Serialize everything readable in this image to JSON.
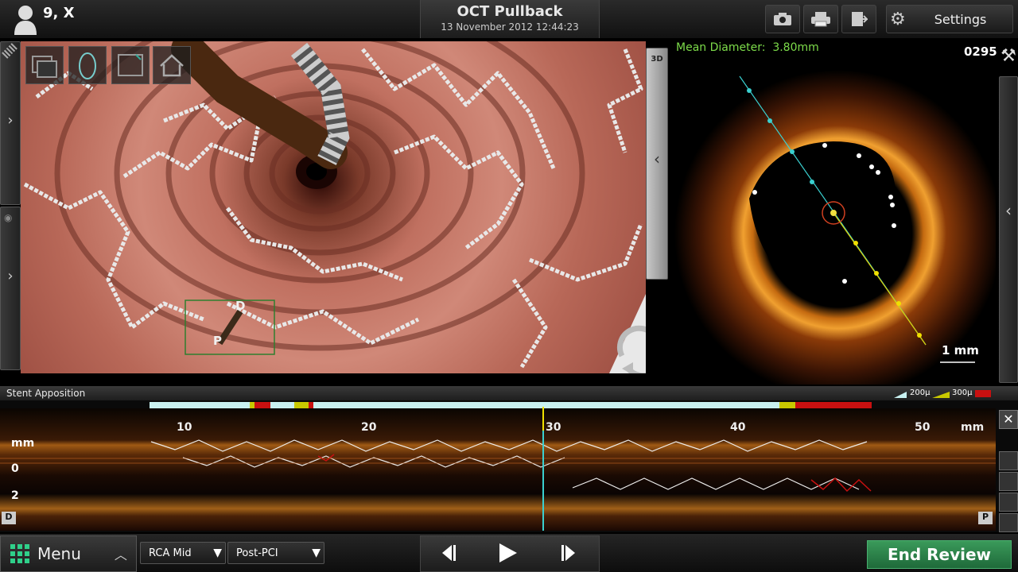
{
  "user": {
    "name": "9, X"
  },
  "title": {
    "app_title": "OCT Pullback",
    "datetime": "13 November 2012 12:44:23"
  },
  "toolbar": {
    "settings_label": "Settings"
  },
  "view3d": {
    "mode_label": "3D",
    "marker_d": "D",
    "marker_p": "P"
  },
  "oct": {
    "mean_diameter": "Mean Diameter:  3.80mm",
    "frame_number": "0295",
    "scale_label": "1 mm"
  },
  "lview": {
    "panel_label": "Stent Apposition",
    "legend": [
      "200µ",
      "300µ"
    ],
    "mm_label": "mm",
    "ticks": [
      "10",
      "20",
      "30",
      "40",
      "50"
    ],
    "axis_labels": [
      "0",
      "2"
    ],
    "end_d": "D",
    "end_p": "P"
  },
  "bottom": {
    "menu_label": "Menu",
    "vessel_select": "RCA Mid",
    "stage_select": "Post-PCI",
    "end_review_label": "End Review"
  },
  "colors": {
    "accent_green": "#2d7d46",
    "legend_cyan": "#c8f0f0",
    "legend_yellow": "#c8c800",
    "legend_red": "#c81010",
    "mean_diameter": "#7ddc4a"
  }
}
